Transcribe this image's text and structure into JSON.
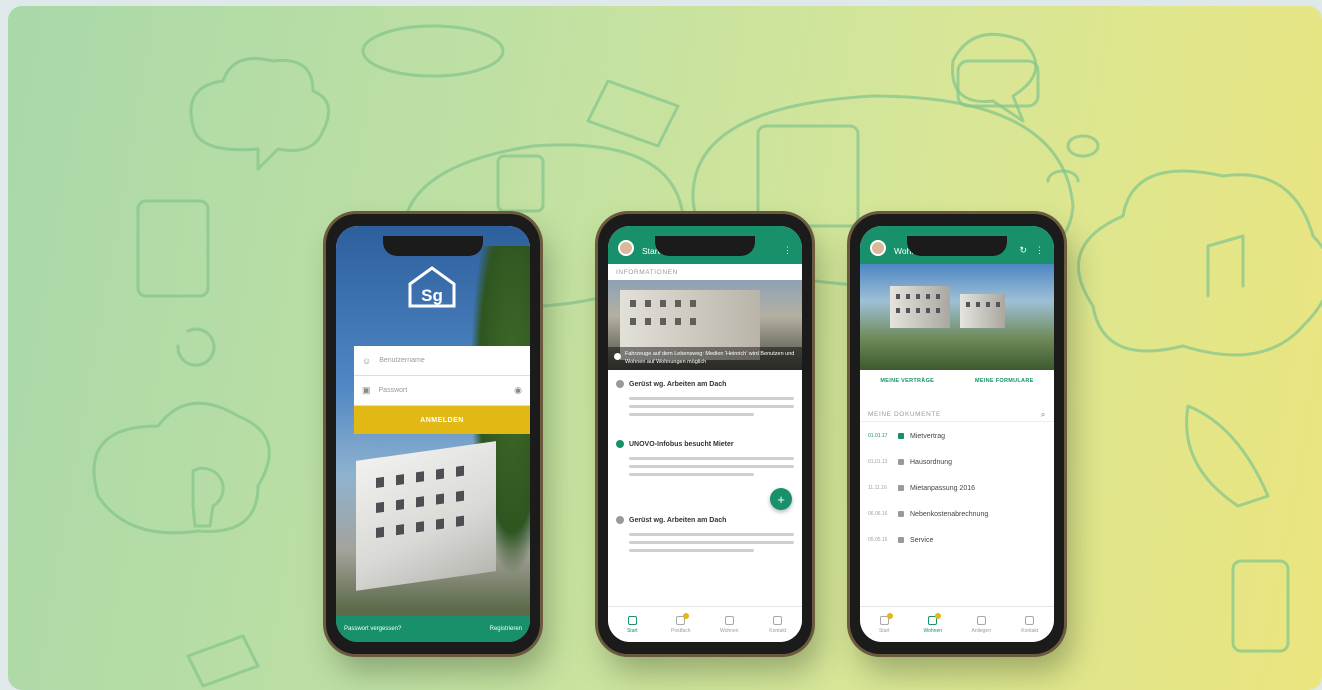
{
  "colors": {
    "brand_green": "#17906b",
    "accent_yellow": "#e2b914",
    "background_start": "#a9d8a9",
    "background_end": "#ebe57e"
  },
  "login_screen": {
    "logo_text": "Sg",
    "username_placeholder": "Benutzername",
    "password_placeholder": "Passwort",
    "login_button": "ANMELDEN",
    "forgot_password": "Passwort vergessen?",
    "register": "Registrieren"
  },
  "start_screen": {
    "title": "Start",
    "section_label": "INFORMATIONEN",
    "hero_caption": "Fahrzeuge auf dem Lebensweg: Medien 'Heinrich' wird Benutzen und Wohnen auf Wohnungen möglich",
    "news": [
      {
        "title": "Gerüst wg. Arbeiten am Dach"
      },
      {
        "title": "UNOVO-Infobus besucht Mieter"
      },
      {
        "title": "Gerüst wg. Arbeiten am Dach"
      }
    ],
    "fab_label": "+",
    "tabs": [
      {
        "label": "Start",
        "icon": "home-icon"
      },
      {
        "label": "Postfach",
        "icon": "mail-icon"
      },
      {
        "label": "Wohnen",
        "icon": "house-icon"
      },
      {
        "label": "Kontakt",
        "icon": "person-icon"
      }
    ]
  },
  "wohnen_screen": {
    "title": "Wohnen",
    "link_contracts": "MEINE VERTRÄGE",
    "link_forms": "MEINE FORMULARE",
    "docs_label": "MEINE DOKUMENTE",
    "documents": [
      {
        "date": "01.01.17",
        "name": "Mietvertrag"
      },
      {
        "date": "01.01.13",
        "name": "Hausordnung"
      },
      {
        "date": "11.11.16",
        "name": "Mietanpassung 2016"
      },
      {
        "date": "06.06.16",
        "name": "Nebenkostenabrechnung"
      },
      {
        "date": "05.05.16",
        "name": "Service"
      }
    ],
    "tabs": [
      {
        "label": "Start",
        "icon": "home-icon"
      },
      {
        "label": "Wohnen",
        "icon": "mail-icon"
      },
      {
        "label": "Anliegen",
        "icon": "house-icon"
      },
      {
        "label": "Kontakt",
        "icon": "person-icon"
      }
    ]
  }
}
